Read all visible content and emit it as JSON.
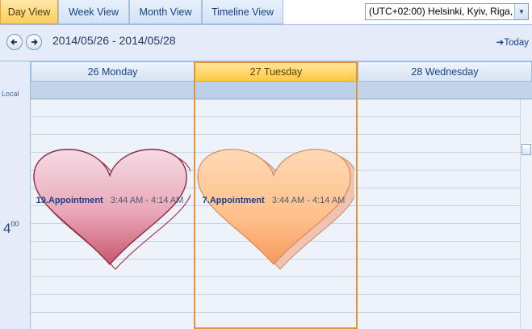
{
  "tabs": [
    {
      "label": "Day View",
      "active": true
    },
    {
      "label": "Week View",
      "active": false
    },
    {
      "label": "Month View",
      "active": false
    },
    {
      "label": "Timeline View",
      "active": false
    }
  ],
  "timezone": {
    "selected": "(UTC+02:00) Helsinki, Kyiv, Riga,"
  },
  "navigation": {
    "date_range": "2014/05/26 - 2014/05/28",
    "today_label": "Today",
    "prev_icon": "arrow-left-icon",
    "next_icon": "arrow-right-icon"
  },
  "time_ruler": {
    "zone_label": "Local",
    "hour": "4",
    "minutes": "00"
  },
  "days": [
    {
      "label": "26 Monday",
      "selected": false
    },
    {
      "label": "27 Tuesday",
      "selected": true
    },
    {
      "label": "28 Wednesday",
      "selected": false
    }
  ],
  "appointments": [
    {
      "subject": "19.Appointment",
      "time": "3:44 AM - 4:14 AM",
      "shape": "heart",
      "color": "#e8a7b8"
    },
    {
      "subject": "7.Appointment",
      "time": "3:44 AM - 4:14 AM",
      "shape": "heart",
      "color": "#ffc08a"
    }
  ],
  "colors": {
    "selected_accent": "#ffc843",
    "selected_border": "#e3943a",
    "header_text": "#15428b"
  }
}
